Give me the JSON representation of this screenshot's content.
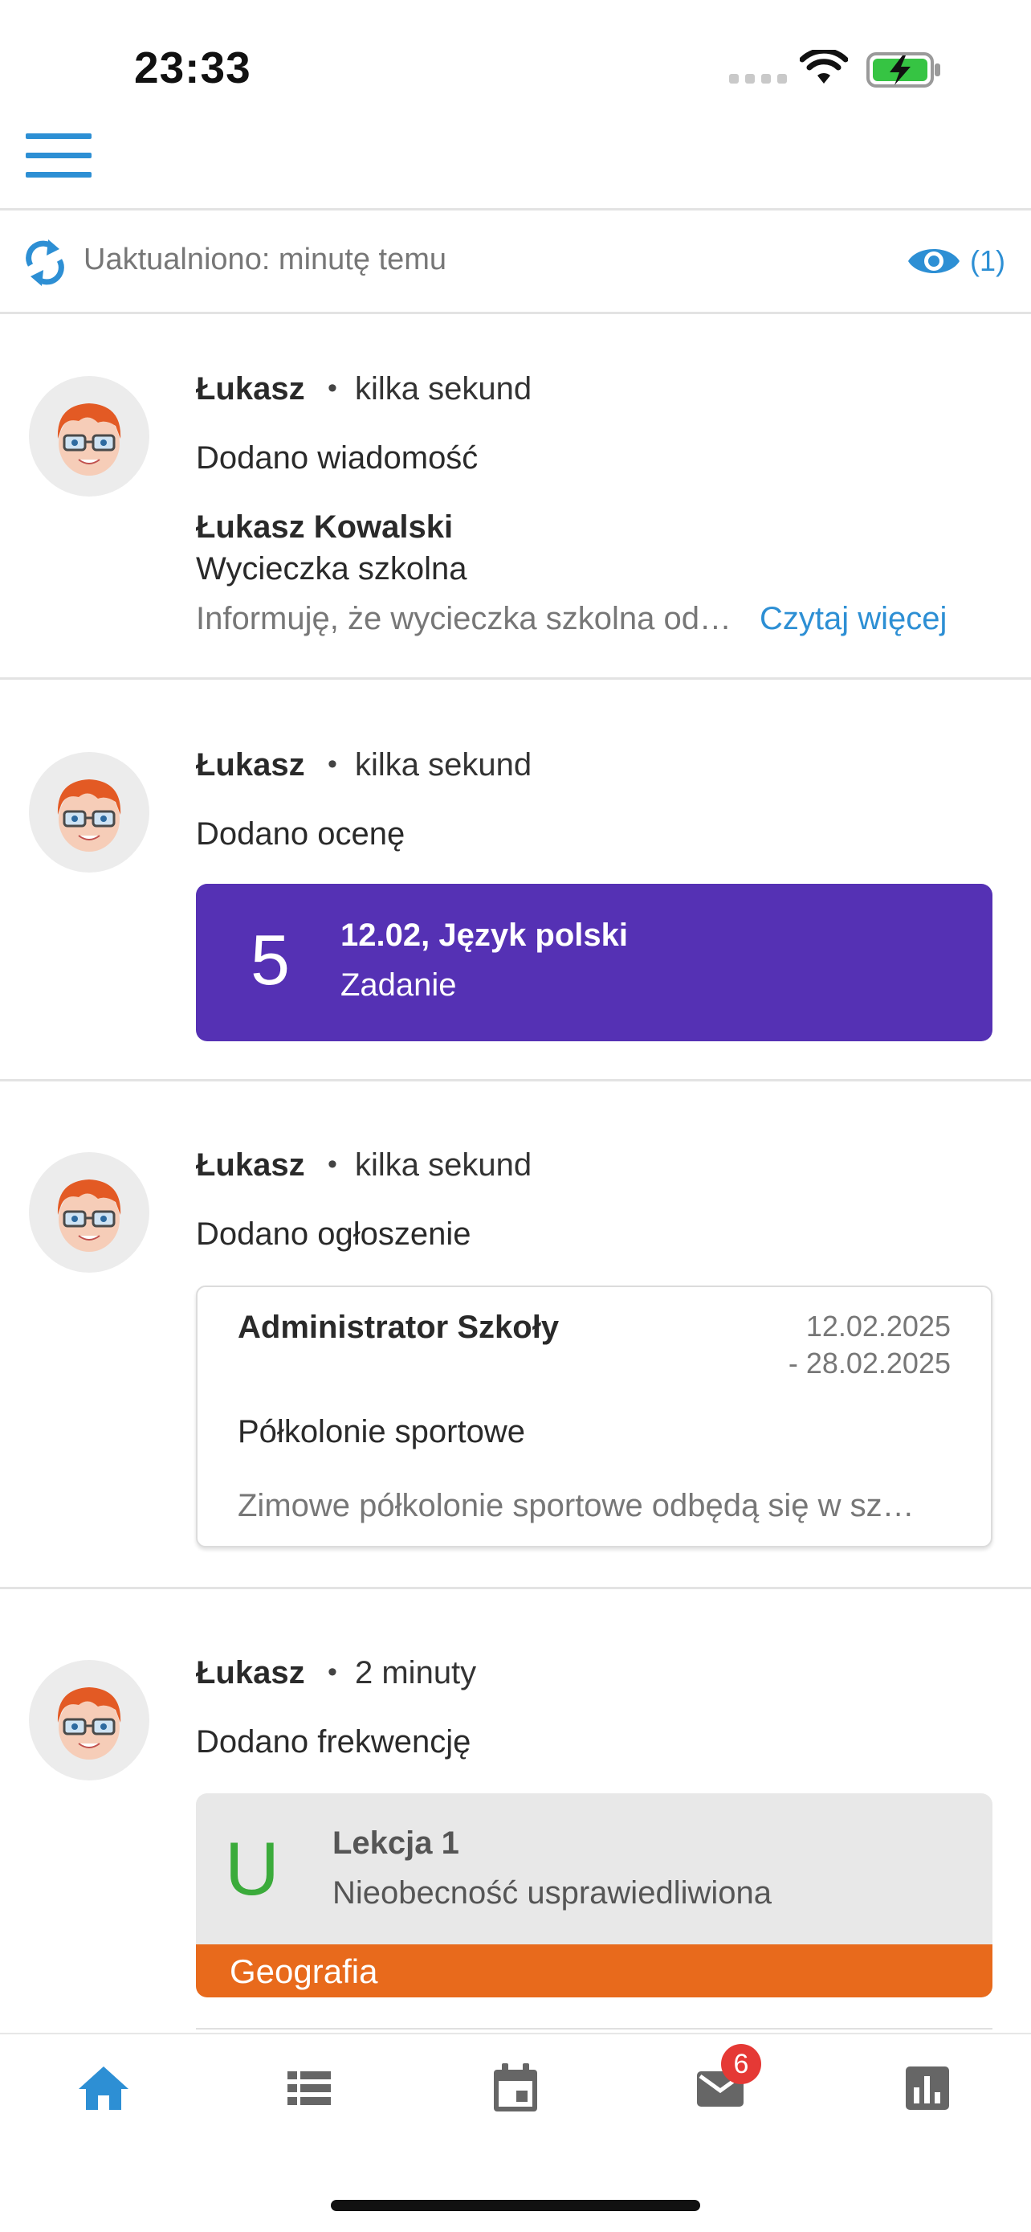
{
  "status_bar": {
    "time": "23:33"
  },
  "update_bar": {
    "text": "Uaktualniono: minutę temu",
    "viewers": "(1)"
  },
  "feed": [
    {
      "author": "Łukasz",
      "when": "kilka sekund",
      "action": "Dodano wiadomość",
      "message": {
        "sender": "Łukasz Kowalski",
        "subject": "Wycieczka szkolna",
        "preview": "Informuję, że wycieczka szkolna od…",
        "read_more": "Czytaj więcej"
      }
    },
    {
      "author": "Łukasz",
      "when": "kilka sekund",
      "action": "Dodano ocenę",
      "grade": {
        "value": "5",
        "title": "12.02, Język polski",
        "type": "Zadanie",
        "color": "#5531b4"
      }
    },
    {
      "author": "Łukasz",
      "when": "kilka sekund",
      "action": "Dodano ogłoszenie",
      "notice": {
        "author": "Administrator Szkoły",
        "date_from": "12.02.2025",
        "date_to": "- 28.02.2025",
        "title": "Półkolonie sportowe",
        "body": "Zimowe półkolonie sportowe odbędą się w sz…"
      }
    },
    {
      "author": "Łukasz",
      "when": "2 minuty",
      "action": "Dodano frekwencję",
      "attendance": {
        "symbol": "U",
        "lesson": "Lekcja 1",
        "status": "Nieobecność usprawiedliwiona",
        "subject": "Geografia",
        "subject_color": "#e86a1c"
      }
    }
  ],
  "tab_bar": {
    "tabs": [
      {
        "icon": "home-icon",
        "active": true
      },
      {
        "icon": "list-icon",
        "active": false
      },
      {
        "icon": "calendar-icon",
        "active": false
      },
      {
        "icon": "mail-icon",
        "active": false
      },
      {
        "icon": "chart-icon",
        "active": false
      }
    ],
    "mail_badge": "6"
  },
  "colors": {
    "accent": "#2d8fd4",
    "grade": "#5531b4",
    "attendance_ok": "#3bab3b",
    "subject_geo": "#e86a1c",
    "tab_inactive": "#666666"
  }
}
